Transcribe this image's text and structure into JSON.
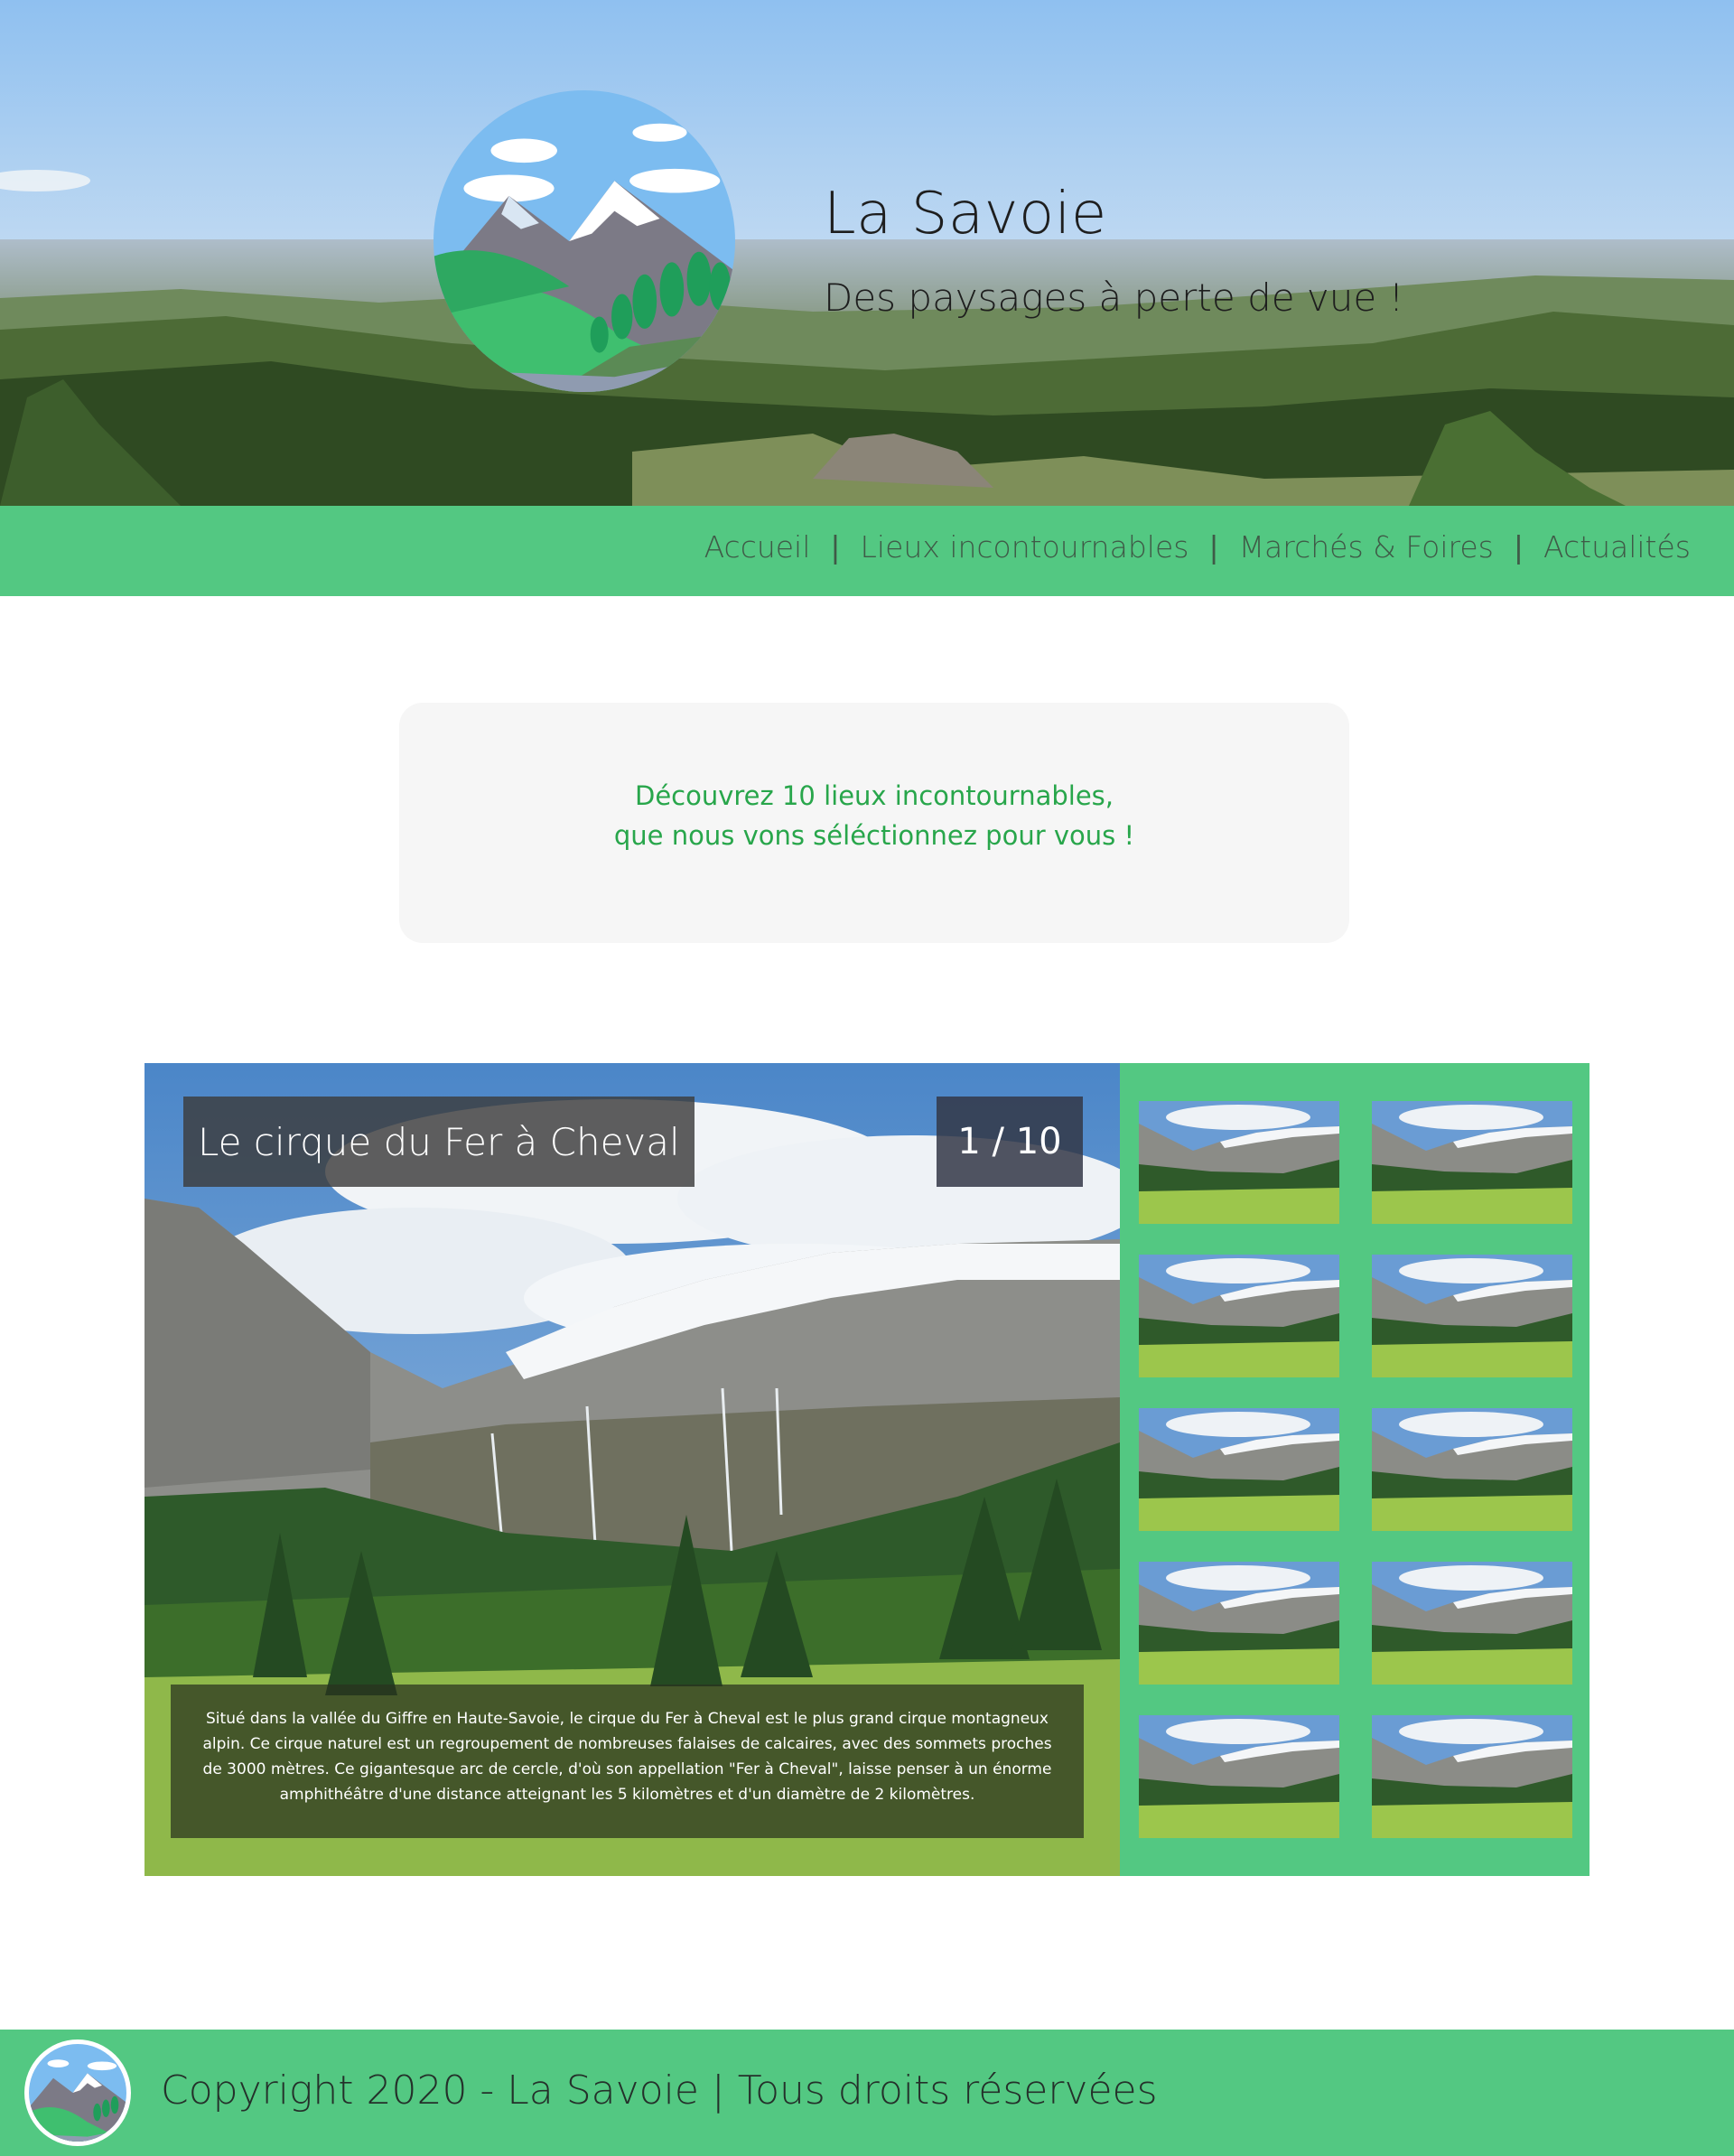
{
  "header": {
    "title": "La Savoie",
    "subtitle": "Des paysages à perte de vue !"
  },
  "nav": {
    "items": [
      {
        "label": "Accueil"
      },
      {
        "label": "Lieux incontournables"
      },
      {
        "label": "Marchés & Foires"
      },
      {
        "label": "Actualités"
      }
    ],
    "separator": "|"
  },
  "intro": {
    "line1": "Découvrez 10 lieux incontournables,",
    "line2": "que nous vons séléctionnez pour vous !"
  },
  "gallery": {
    "current_title": "Le cirque du Fer à Cheval",
    "counter": "1 / 10",
    "description": "Situé dans la vallée du Giffre en Haute-Savoie, le cirque du Fer à Cheval est le plus grand cirque montagneux alpin. Ce cirque naturel est un regroupement de nombreuses falaises de calcaires, avec des sommets proches de 3000 mètres. Ce gigantesque arc de cercle, d'où son appellation \"Fer à Cheval\", laisse penser à un énorme amphithéâtre d'une distance atteignant les 5 kilomètres et d'un diamètre de 2 kilomètres.",
    "thumbnail_count": 10
  },
  "footer": {
    "copyright": "Copyright 2020 - La Savoie | Tous droits réservées"
  },
  "colors": {
    "brand_green": "#53c882",
    "intro_text": "#28a64b",
    "intro_bg": "#f6f6f6"
  },
  "icons": {
    "logo": "mountain-landscape-logo"
  }
}
